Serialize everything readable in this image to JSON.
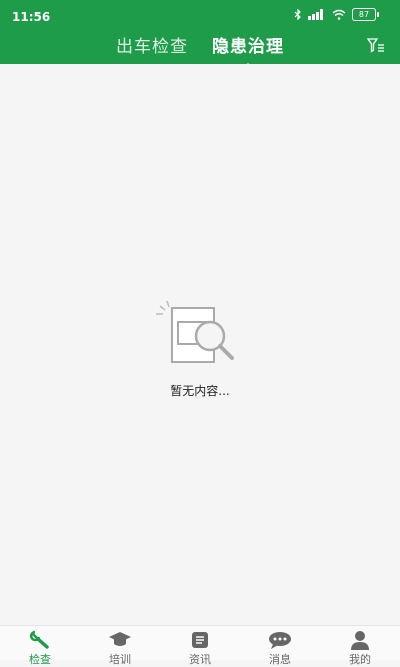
{
  "status": {
    "time": "11:56",
    "battery": "87"
  },
  "tabs": [
    {
      "label": "出车检查",
      "active": false
    },
    {
      "label": "隐患治理",
      "active": true
    }
  ],
  "empty": {
    "message": "暂无内容..."
  },
  "nav": [
    {
      "label": "检查",
      "icon": "wrench-icon",
      "active": true
    },
    {
      "label": "培训",
      "icon": "graduation-cap-icon",
      "active": false
    },
    {
      "label": "资讯",
      "icon": "news-icon",
      "active": false
    },
    {
      "label": "消息",
      "icon": "chat-icon",
      "active": false
    },
    {
      "label": "我的",
      "icon": "user-icon",
      "active": false
    }
  ],
  "colors": {
    "brand": "#1e9c4a",
    "background": "#f5f5f5"
  }
}
